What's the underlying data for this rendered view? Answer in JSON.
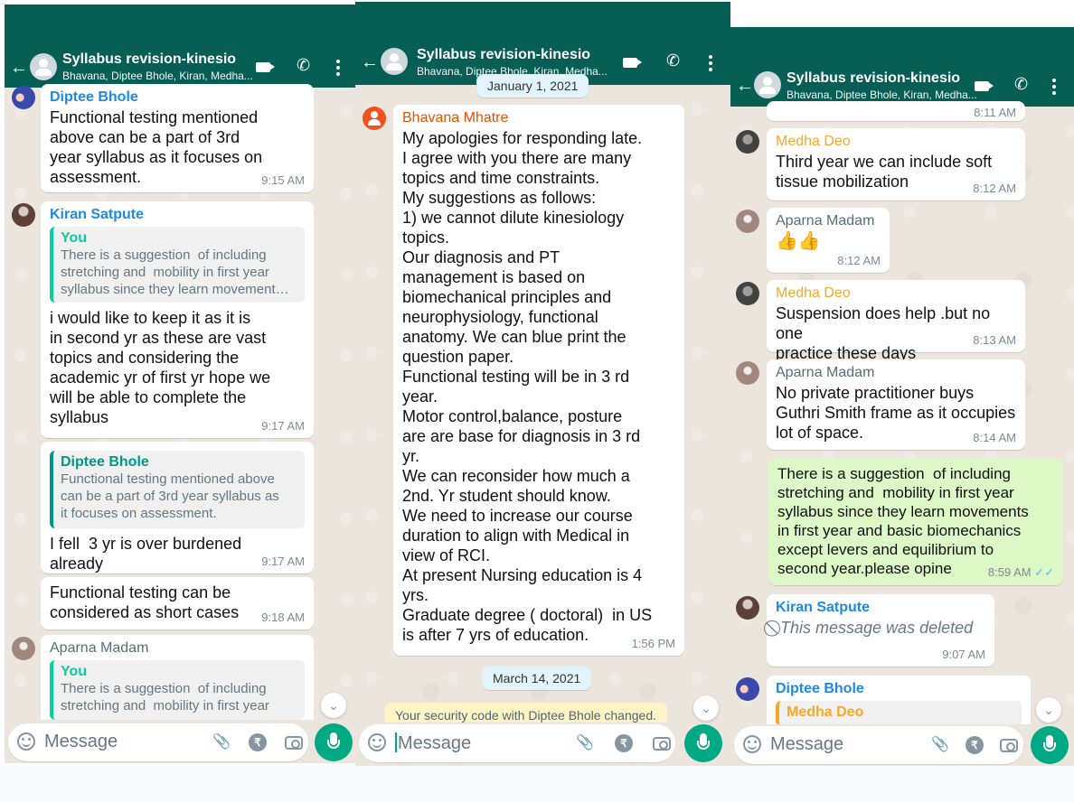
{
  "chat": {
    "title": "Syllabus revision-kinesio",
    "subtitle": "Bhavana, Diptee Bhole, Kiran, Medha..."
  },
  "input": {
    "placeholder": "Message"
  },
  "colors": {
    "header": "#075e54",
    "accent": "#00a884",
    "outgoing": "#dcf8c6",
    "chat_bg": "#ece5dd"
  },
  "icons": [
    "back-arrow-icon",
    "group-avatar-icon",
    "video-call-icon",
    "phone-icon",
    "menu-dots-icon",
    "emoji-icon",
    "attach-icon",
    "rupee-icon",
    "camera-icon",
    "mic-icon",
    "chevron-down-icon",
    "blocked-icon"
  ],
  "panel1": {
    "m1": {
      "sender": "Diptee Bhole",
      "text": "Functional testing mentioned\nabove can be a part of 3rd\nyear syllabus as it focuses on\nassessment.",
      "time": "9:15 AM"
    },
    "m2": {
      "sender": "Kiran Satpute",
      "quote_name": "You",
      "quote_text": "There is a suggestion  of including\nstretching and  mobility in first year\nsyllabus since they learn movement…",
      "text": "i would like to keep it as it is\nin second yr as these are vast\ntopics and considering the\nacademic yr of first yr hope we\nwill be able to complete the\nsyllabus",
      "time": "9:17 AM"
    },
    "m3": {
      "quote_name": "Diptee Bhole",
      "quote_text": "Functional testing mentioned above\ncan be a part of 3rd year syllabus as\nit focuses on assessment.",
      "text": "I fell  3 yr is over burdened\nalready",
      "time": "9:17 AM"
    },
    "m4": {
      "text": "Functional testing can be\nconsidered as short cases",
      "time": "9:18 AM"
    },
    "m5": {
      "sender": "Aparna Madam",
      "quote_name": "You",
      "quote_text": "There is a suggestion  of including\nstretching and  mobility in first year"
    }
  },
  "panel2": {
    "date_top": "January 1, 2021",
    "m1": {
      "sender": "Bhavana Mhatre",
      "text": "My apologies for responding late.\nI agree with you there are many\ntopics and time constraints.\nMy suggestions as follows:\n1) we cannot dilute kinesiology\ntopics.\nOur diagnosis and PT\nmanagement is based on\nbiomechanical principles and\nneurophysiology, functional\nanatomy. We can blue print the\nquestion paper.\nFunctional testing will be in 3 rd\nyear.\nMotor control,balance, posture\nare are base for diagnosis in 3 rd\nyr.\nWe can reconsider how much a\n2nd. Yr student should know.\nWe need to increase our course\nduration to align with Medical in\nview of RCI.\nAt present Nursing education is 4\nyrs.\nGraduate degree ( doctoral)  in US\nis after 7 yrs of education.",
      "time": "1:56 PM"
    },
    "date_chip": "March 14, 2021",
    "system": "Your security code with Diptee Bhole changed."
  },
  "panel3": {
    "top_time": "8:11 AM",
    "m1": {
      "sender": "Medha Deo",
      "text": "Third year we can include soft\ntissue mobilization",
      "time": "8:12 AM"
    },
    "m2": {
      "sender": "Aparna Madam",
      "text": "👍👍",
      "time": "8:12 AM"
    },
    "m3": {
      "sender": "Medha Deo",
      "text": "Suspension does help .but no one\npractice these days",
      "time": "8:13 AM"
    },
    "m4": {
      "sender": "Aparna Madam",
      "text": "No private practitioner buys\nGuthri Smith frame as it occupies\nlot of space.",
      "time": "8:14 AM"
    },
    "m5": {
      "text": "There is a suggestion  of including\nstretching and  mobility in first year\nsyllabus since they learn movements\nin first year and basic biomechanics\nexcept levers and equilibrium to\nsecond year.please opine",
      "time": "8:59 AM"
    },
    "m6": {
      "sender": "Kiran Satpute",
      "text": "This message was deleted",
      "time": "9:07 AM"
    },
    "m7": {
      "sender": "Diptee Bhole",
      "quote_name": "Medha Deo"
    }
  }
}
